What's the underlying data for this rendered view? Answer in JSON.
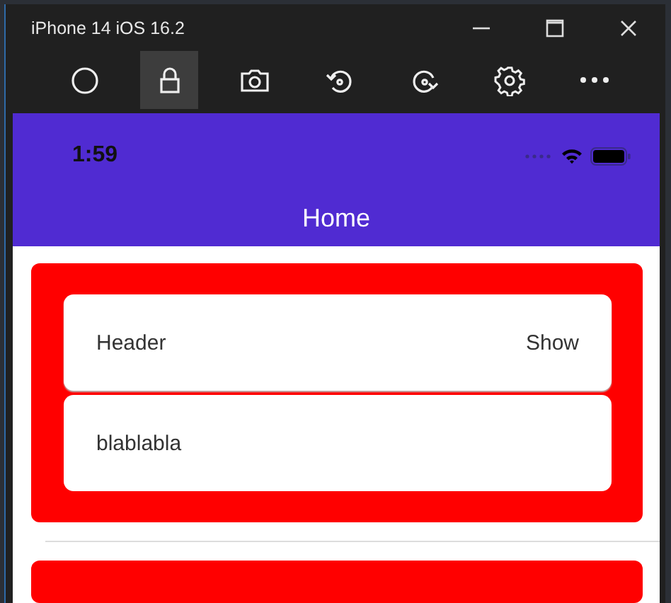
{
  "window": {
    "title": "iPhone 14 iOS 16.2"
  },
  "toolbar": [
    {
      "kind": "home",
      "selected": false
    },
    {
      "kind": "lock",
      "selected": true
    },
    {
      "kind": "screenshot",
      "selected": false
    },
    {
      "kind": "rotate-left",
      "selected": false
    },
    {
      "kind": "rotate-right",
      "selected": false
    },
    {
      "kind": "settings",
      "selected": false
    },
    {
      "kind": "more",
      "selected": false
    }
  ],
  "status_bar": {
    "time": "1:59"
  },
  "nav_bar": {
    "title": "Home"
  },
  "cards": [
    {
      "kind": "expander",
      "header": "Header",
      "action": "Show",
      "content": "blablabla"
    },
    {
      "kind": "partial"
    }
  ]
}
